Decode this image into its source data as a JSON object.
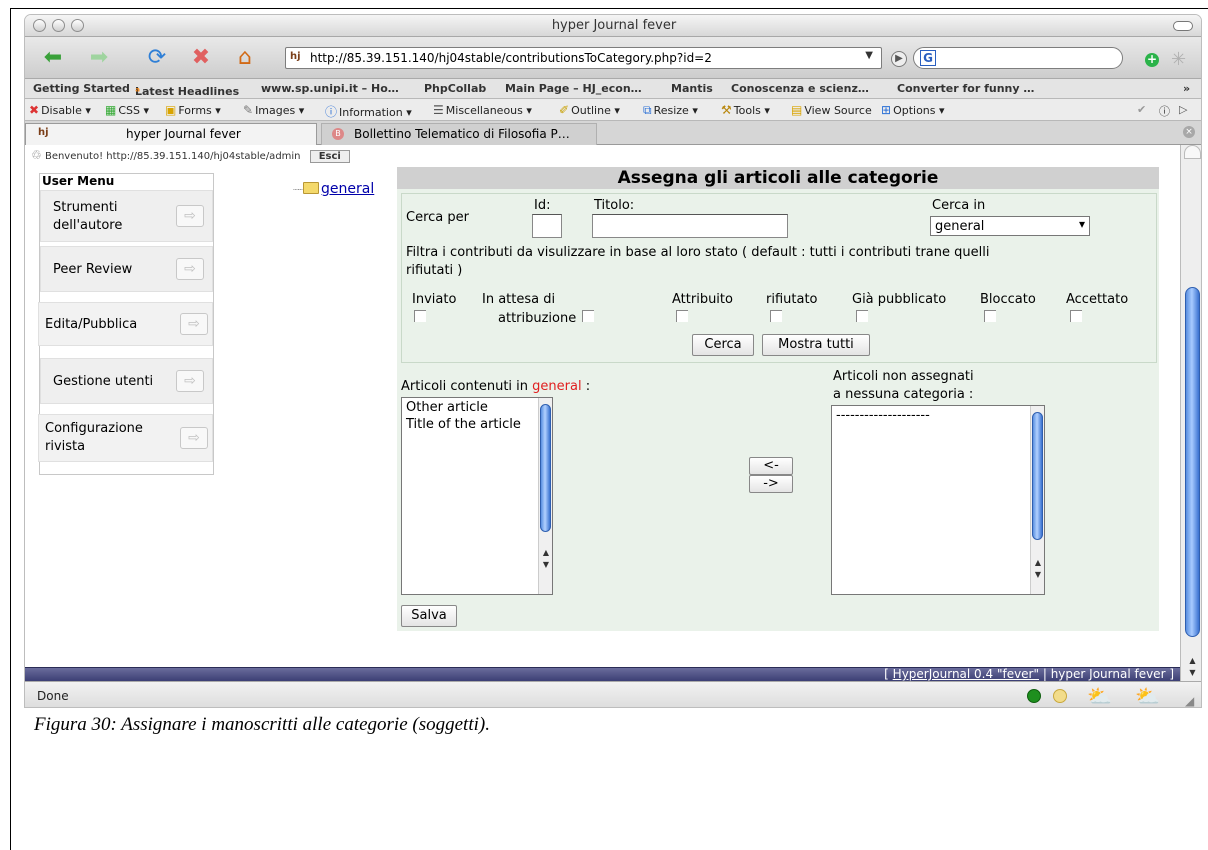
{
  "window": {
    "title": "hyper Journal fever"
  },
  "toolbar": {
    "url": "http://85.39.151.140/hj04stable/contributionsToCategory.php?id=2",
    "icons": [
      "back-arrow-icon",
      "forward-arrow-icon",
      "reload-icon",
      "stop-icon",
      "home-icon"
    ]
  },
  "bookmarks": [
    "Getting Started",
    "Latest Headlines",
    "www.sp.unipi.it – Ho…",
    "PhpCollab",
    "Main Page – HJ_econ…",
    "Mantis",
    "Conoscenza e scienz…",
    "Converter for funny …"
  ],
  "webdev": [
    "Disable",
    "CSS",
    "Forms",
    "Images",
    "Information",
    "Miscellaneous",
    "Outline",
    "Resize",
    "Tools",
    "View Source",
    "Options"
  ],
  "tabs": [
    "hyper Journal fever",
    "Bollettino Telematico di Filosofia P…"
  ],
  "page": {
    "welcome": "Benvenuto! http://85.39.151.140/hj04stable/admin",
    "logout_label": "Esci",
    "user_menu": {
      "title": "User Menu",
      "items": [
        "Strumenti dell'autore",
        "Peer Review",
        "Edita/Pubblica",
        "Gestione utenti",
        "Configurazione rivista"
      ]
    },
    "tree": {
      "label": "general"
    },
    "main": {
      "heading": "Assegna gli articoli alle categorie",
      "search_label": "Cerca per",
      "id_label": "Id:",
      "title_label": "Titolo:",
      "cerca_in_label": "Cerca in",
      "cerca_in_value": "general",
      "filter_text_1": "Filtra i contributi da visulizzare in base al loro stato ( default : tutti i contributi trane quelli",
      "filter_text_2": "rifiutati )",
      "statuses": [
        "Inviato",
        "In attesa di",
        "attribuzione",
        "Attribuito",
        "rifiutato",
        "Già pubblicato",
        "Bloccato",
        "Accettato"
      ],
      "search_button": "Cerca",
      "show_all_button": "Mostra tutti",
      "contained_label": "Articoli contenuti in",
      "contained_category": "general",
      "contained_suffix": ":",
      "contained_items": [
        "Other article",
        "Title of the article"
      ],
      "unassigned_label_1": "Articoli non assegnati",
      "unassigned_label_2": "a nessuna categoria :",
      "unassigned_items": [
        "--------------------"
      ],
      "move_left": "<-",
      "move_right": "->",
      "save_button": "Salva"
    },
    "footer": {
      "open": "[",
      "link": "HyperJournal 0.4 \"fever\"",
      "rest": "| hyper Journal fever ]"
    }
  },
  "status": {
    "text": "Done"
  },
  "caption": "Figura 30: Assignare i manoscritti alle categorie (soggetti)."
}
